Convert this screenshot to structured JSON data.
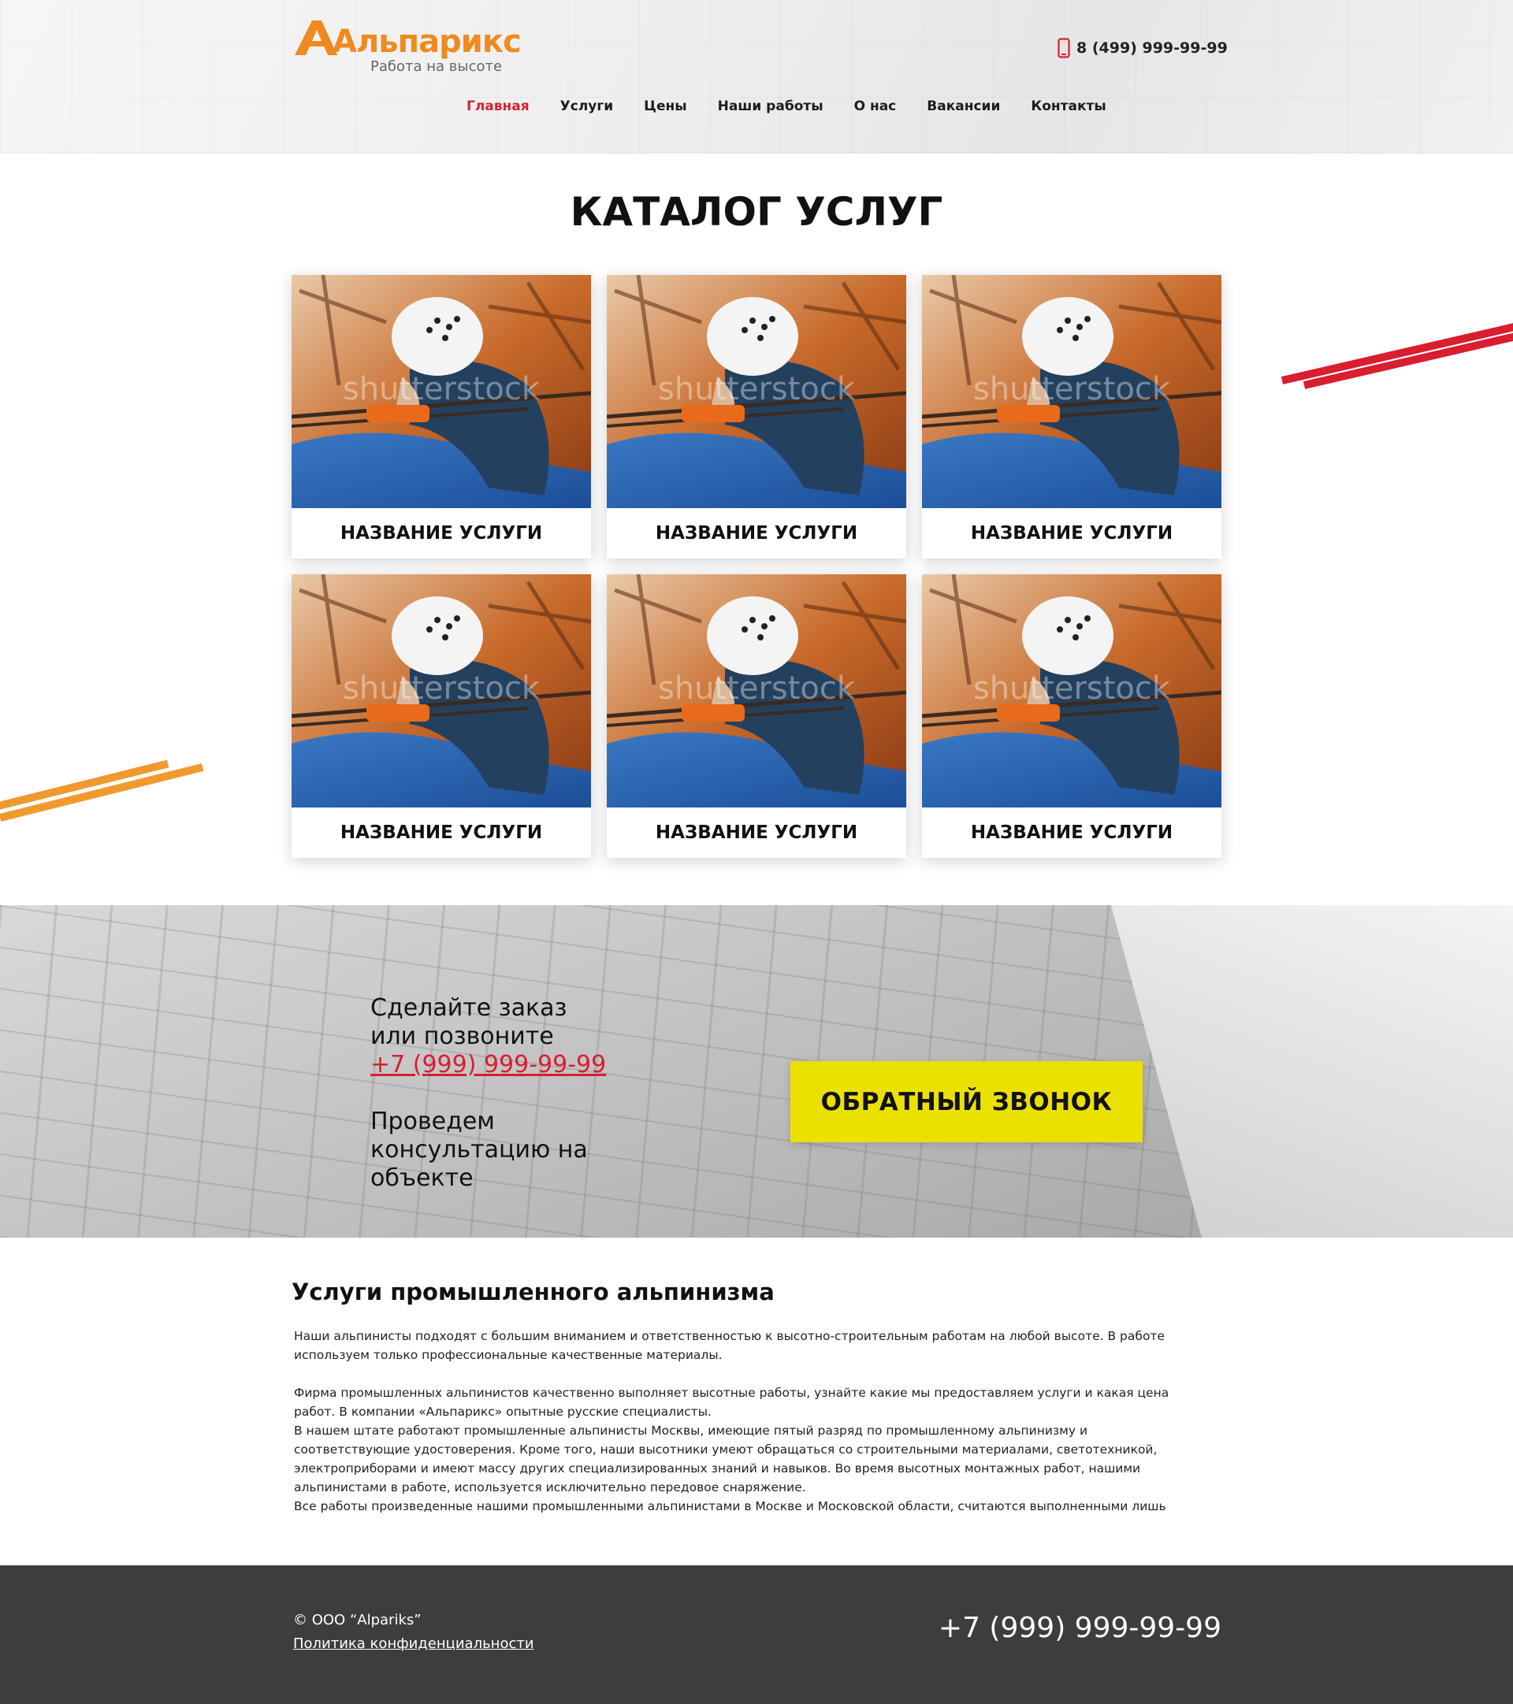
{
  "header": {
    "logo_name": "Альпарикс",
    "logo_sub": "Работа на высоте",
    "phone": "8 (499) 999-99-99",
    "nav": [
      {
        "label": "Главная"
      },
      {
        "label": "Услуги"
      },
      {
        "label": "Цены"
      },
      {
        "label": "Наши работы"
      },
      {
        "label": "О нас"
      },
      {
        "label": "Вакансии"
      },
      {
        "label": "Контакты"
      }
    ],
    "active_nav": "Главная"
  },
  "catalog": {
    "title": "КАТАЛОГ УСЛУГ",
    "cards": [
      {
        "title": "НАЗВАНИЕ УСЛУГИ",
        "watermark": "shutterstock"
      },
      {
        "title": "НАЗВАНИЕ УСЛУГИ",
        "watermark": "shutterstock"
      },
      {
        "title": "НАЗВАНИЕ УСЛУГИ",
        "watermark": "shutterstock"
      },
      {
        "title": "НАЗВАНИЕ УСЛУГИ",
        "watermark": "shutterstock"
      },
      {
        "title": "НАЗВАНИЕ УСЛУГИ",
        "watermark": "shutterstock"
      },
      {
        "title": "НАЗВАНИЕ УСЛУГИ",
        "watermark": "shutterstock"
      }
    ]
  },
  "cta": {
    "line1": "Сделайте заказ",
    "line2": "или позвоните",
    "phone": "+7 (999) 999-99-99",
    "line3": "Проведем",
    "line4": "консультацию на",
    "line5": "объекте",
    "button_label": "ОБРАТНЫЙ ЗВОНОК"
  },
  "about": {
    "title": "Услуги промышленного альпинизма",
    "p1_l1": "Наши альпинисты подходят с большим вниманием и ответственностью к высотно-строительным работам на любой высоте. В работе",
    "p1_l2": "используем только профессиональные качественные  материалы.",
    "p2_l1": "Фирма промышленных альпинистов качественно выполняет высотные работы, узнайте какие мы предоставляем услуги и какая цена",
    "p2_l2": "работ. В компании «Альпарикс» опытные русские специалисты.",
    "p2_l3": "В нашем штате работают промышленные альпинисты Москвы, имеющие пятый разряд по промышленному альпинизму и",
    "p2_l4": "соответствующие удостоверения. Кроме того, наши высотники умеют обращаться со строительными материалами, светотехникой,",
    "p2_l5": "электроприборами и имеют массу других специализированных знаний и навыков. Во время высотных монтажных работ, нашими",
    "p2_l6": "альпинистами в работе, используется исключительно передовое снаряжение.",
    "p2_l7": "Все работы произведенные нашими промышленными альпинистами в Москве и Московской области, считаются выполненными лишь"
  },
  "footer": {
    "copyright": "© ООО “Alpariks”",
    "policy": "Политика конфиденциальности",
    "phone": "+7 (999) 999-99-99"
  },
  "colors": {
    "accent_red": "#d81e2f",
    "logo_orange": "#ef8a21",
    "button_yellow": "#ebe100",
    "footer_bg": "#3d3d3d"
  }
}
